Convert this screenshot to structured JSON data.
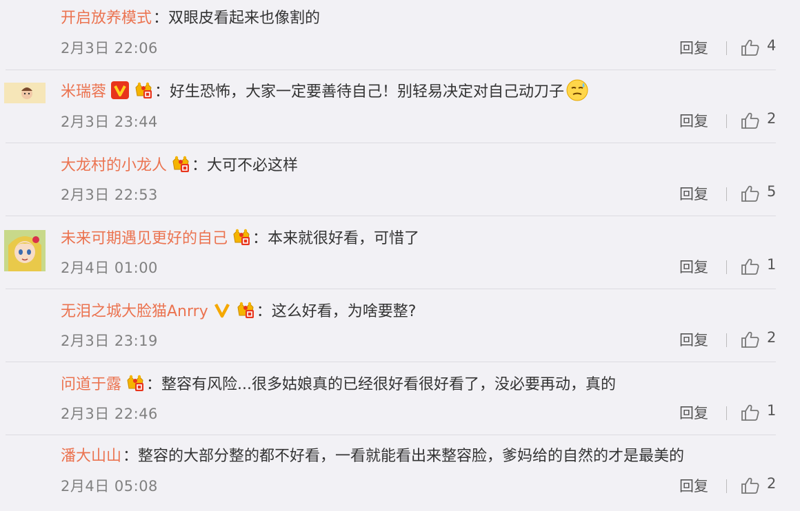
{
  "comments": [
    {
      "username": "开启放养模式",
      "text": "双眼皮看起来也像割的",
      "date": "2月3日 22:06",
      "reply": "回复",
      "likes": "4"
    },
    {
      "username": "米瑞蓉",
      "text": "好生恐怖，大家一定要善待自己！别轻易决定对自己动刀子",
      "date": "2月3日 23:44",
      "reply": "回复",
      "likes": "2"
    },
    {
      "username": "大龙村的小龙人",
      "text": "大可不必这样",
      "date": "2月3日 22:53",
      "reply": "回复",
      "likes": "5"
    },
    {
      "username": "未来可期遇见更好的自己",
      "text": "本来就很好看，可惜了",
      "date": "2月4日 01:00",
      "reply": "回复",
      "likes": "1"
    },
    {
      "username": "无泪之城大脸猫Anrry",
      "text": "这么好看，为啥要整?",
      "date": "2月3日 23:19",
      "reply": "回复",
      "likes": "2"
    },
    {
      "username": "问道于露",
      "text": "整容有风险...很多姑娘真的已经很好看很好看了，没必要再动，真的",
      "date": "2月3日 22:46",
      "reply": "回复",
      "likes": "1"
    },
    {
      "username": "潘大山山",
      "text": "整容的大部分整的都不好看，一看就能看出来整容脸，爹妈给的自然的才是最美的",
      "date": "2月4日 05:08",
      "reply": "回复",
      "likes": "2"
    }
  ],
  "colon": "：",
  "colors": {
    "username": "#eb7350",
    "text": "#333333",
    "meta": "#808080",
    "background": "#f2f1f5"
  }
}
